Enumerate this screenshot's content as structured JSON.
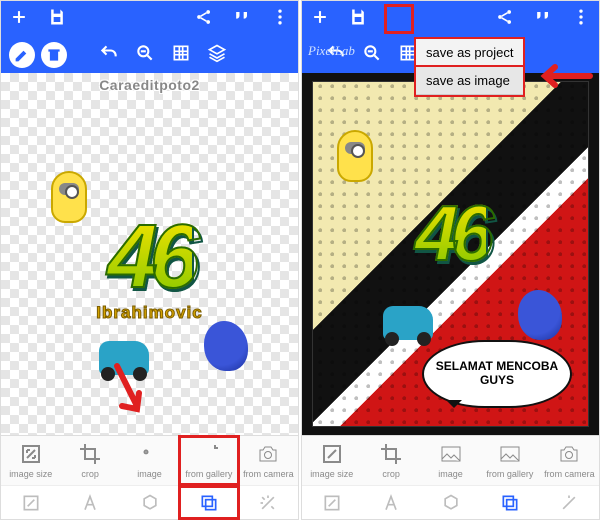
{
  "watermark": "Caraeditpoto2",
  "app_brand": "PixelLab",
  "artwork": {
    "number": "46",
    "subtitle": "Ibrahimovic"
  },
  "speech_bubble": "SELAMAT MENCOBA GUYS",
  "save_menu": {
    "opt1": "save as project",
    "opt2": "save as image"
  },
  "tools": {
    "image_size": "image size",
    "crop": "crop",
    "image": "image",
    "from_gallery": "from gallery",
    "from_camera": "from camera"
  },
  "colors": {
    "accent": "#2962ff",
    "highlight": "#e02020"
  }
}
